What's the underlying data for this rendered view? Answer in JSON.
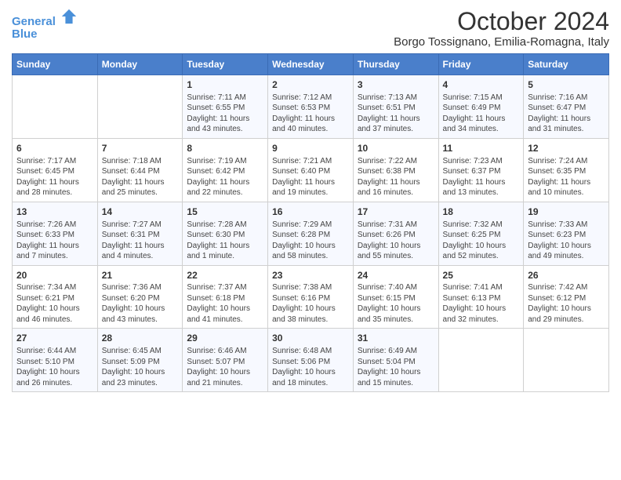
{
  "logo": {
    "line1": "General",
    "line2": "Blue"
  },
  "title": "October 2024",
  "subtitle": "Borgo Tossignano, Emilia-Romagna, Italy",
  "days_of_week": [
    "Sunday",
    "Monday",
    "Tuesday",
    "Wednesday",
    "Thursday",
    "Friday",
    "Saturday"
  ],
  "weeks": [
    [
      {
        "num": "",
        "sunrise": "",
        "sunset": "",
        "daylight": ""
      },
      {
        "num": "",
        "sunrise": "",
        "sunset": "",
        "daylight": ""
      },
      {
        "num": "1",
        "sunrise": "Sunrise: 7:11 AM",
        "sunset": "Sunset: 6:55 PM",
        "daylight": "Daylight: 11 hours and 43 minutes."
      },
      {
        "num": "2",
        "sunrise": "Sunrise: 7:12 AM",
        "sunset": "Sunset: 6:53 PM",
        "daylight": "Daylight: 11 hours and 40 minutes."
      },
      {
        "num": "3",
        "sunrise": "Sunrise: 7:13 AM",
        "sunset": "Sunset: 6:51 PM",
        "daylight": "Daylight: 11 hours and 37 minutes."
      },
      {
        "num": "4",
        "sunrise": "Sunrise: 7:15 AM",
        "sunset": "Sunset: 6:49 PM",
        "daylight": "Daylight: 11 hours and 34 minutes."
      },
      {
        "num": "5",
        "sunrise": "Sunrise: 7:16 AM",
        "sunset": "Sunset: 6:47 PM",
        "daylight": "Daylight: 11 hours and 31 minutes."
      }
    ],
    [
      {
        "num": "6",
        "sunrise": "Sunrise: 7:17 AM",
        "sunset": "Sunset: 6:45 PM",
        "daylight": "Daylight: 11 hours and 28 minutes."
      },
      {
        "num": "7",
        "sunrise": "Sunrise: 7:18 AM",
        "sunset": "Sunset: 6:44 PM",
        "daylight": "Daylight: 11 hours and 25 minutes."
      },
      {
        "num": "8",
        "sunrise": "Sunrise: 7:19 AM",
        "sunset": "Sunset: 6:42 PM",
        "daylight": "Daylight: 11 hours and 22 minutes."
      },
      {
        "num": "9",
        "sunrise": "Sunrise: 7:21 AM",
        "sunset": "Sunset: 6:40 PM",
        "daylight": "Daylight: 11 hours and 19 minutes."
      },
      {
        "num": "10",
        "sunrise": "Sunrise: 7:22 AM",
        "sunset": "Sunset: 6:38 PM",
        "daylight": "Daylight: 11 hours and 16 minutes."
      },
      {
        "num": "11",
        "sunrise": "Sunrise: 7:23 AM",
        "sunset": "Sunset: 6:37 PM",
        "daylight": "Daylight: 11 hours and 13 minutes."
      },
      {
        "num": "12",
        "sunrise": "Sunrise: 7:24 AM",
        "sunset": "Sunset: 6:35 PM",
        "daylight": "Daylight: 11 hours and 10 minutes."
      }
    ],
    [
      {
        "num": "13",
        "sunrise": "Sunrise: 7:26 AM",
        "sunset": "Sunset: 6:33 PM",
        "daylight": "Daylight: 11 hours and 7 minutes."
      },
      {
        "num": "14",
        "sunrise": "Sunrise: 7:27 AM",
        "sunset": "Sunset: 6:31 PM",
        "daylight": "Daylight: 11 hours and 4 minutes."
      },
      {
        "num": "15",
        "sunrise": "Sunrise: 7:28 AM",
        "sunset": "Sunset: 6:30 PM",
        "daylight": "Daylight: 11 hours and 1 minute."
      },
      {
        "num": "16",
        "sunrise": "Sunrise: 7:29 AM",
        "sunset": "Sunset: 6:28 PM",
        "daylight": "Daylight: 10 hours and 58 minutes."
      },
      {
        "num": "17",
        "sunrise": "Sunrise: 7:31 AM",
        "sunset": "Sunset: 6:26 PM",
        "daylight": "Daylight: 10 hours and 55 minutes."
      },
      {
        "num": "18",
        "sunrise": "Sunrise: 7:32 AM",
        "sunset": "Sunset: 6:25 PM",
        "daylight": "Daylight: 10 hours and 52 minutes."
      },
      {
        "num": "19",
        "sunrise": "Sunrise: 7:33 AM",
        "sunset": "Sunset: 6:23 PM",
        "daylight": "Daylight: 10 hours and 49 minutes."
      }
    ],
    [
      {
        "num": "20",
        "sunrise": "Sunrise: 7:34 AM",
        "sunset": "Sunset: 6:21 PM",
        "daylight": "Daylight: 10 hours and 46 minutes."
      },
      {
        "num": "21",
        "sunrise": "Sunrise: 7:36 AM",
        "sunset": "Sunset: 6:20 PM",
        "daylight": "Daylight: 10 hours and 43 minutes."
      },
      {
        "num": "22",
        "sunrise": "Sunrise: 7:37 AM",
        "sunset": "Sunset: 6:18 PM",
        "daylight": "Daylight: 10 hours and 41 minutes."
      },
      {
        "num": "23",
        "sunrise": "Sunrise: 7:38 AM",
        "sunset": "Sunset: 6:16 PM",
        "daylight": "Daylight: 10 hours and 38 minutes."
      },
      {
        "num": "24",
        "sunrise": "Sunrise: 7:40 AM",
        "sunset": "Sunset: 6:15 PM",
        "daylight": "Daylight: 10 hours and 35 minutes."
      },
      {
        "num": "25",
        "sunrise": "Sunrise: 7:41 AM",
        "sunset": "Sunset: 6:13 PM",
        "daylight": "Daylight: 10 hours and 32 minutes."
      },
      {
        "num": "26",
        "sunrise": "Sunrise: 7:42 AM",
        "sunset": "Sunset: 6:12 PM",
        "daylight": "Daylight: 10 hours and 29 minutes."
      }
    ],
    [
      {
        "num": "27",
        "sunrise": "Sunrise: 6:44 AM",
        "sunset": "Sunset: 5:10 PM",
        "daylight": "Daylight: 10 hours and 26 minutes."
      },
      {
        "num": "28",
        "sunrise": "Sunrise: 6:45 AM",
        "sunset": "Sunset: 5:09 PM",
        "daylight": "Daylight: 10 hours and 23 minutes."
      },
      {
        "num": "29",
        "sunrise": "Sunrise: 6:46 AM",
        "sunset": "Sunset: 5:07 PM",
        "daylight": "Daylight: 10 hours and 21 minutes."
      },
      {
        "num": "30",
        "sunrise": "Sunrise: 6:48 AM",
        "sunset": "Sunset: 5:06 PM",
        "daylight": "Daylight: 10 hours and 18 minutes."
      },
      {
        "num": "31",
        "sunrise": "Sunrise: 6:49 AM",
        "sunset": "Sunset: 5:04 PM",
        "daylight": "Daylight: 10 hours and 15 minutes."
      },
      {
        "num": "",
        "sunrise": "",
        "sunset": "",
        "daylight": ""
      },
      {
        "num": "",
        "sunrise": "",
        "sunset": "",
        "daylight": ""
      }
    ]
  ]
}
